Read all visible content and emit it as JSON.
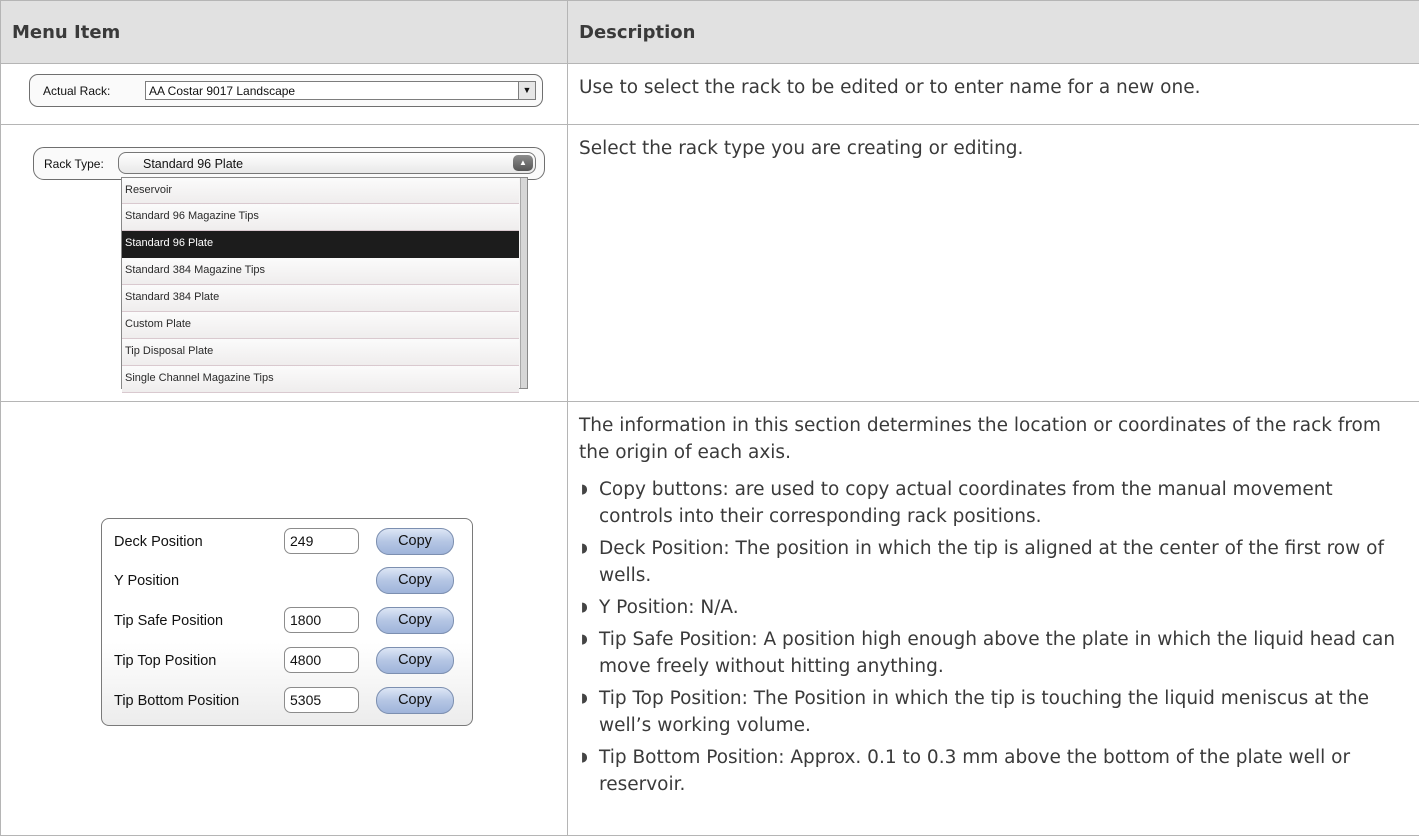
{
  "table": {
    "col_menu_item": "Menu Item",
    "col_description": "Description"
  },
  "actual_rack": {
    "label": "Actual Rack:",
    "value": "AA Costar 9017 Landscape",
    "dropdown_icon": "chevron-down-icon",
    "description": "Use to select the rack to be edited or to enter name for a new one."
  },
  "rack_type": {
    "label": "Rack Type:",
    "value": "Standard 96 Plate",
    "dropdown_icon": "chevron-up-icon",
    "options": [
      "Reservoir",
      "Standard 96 Magazine Tips",
      "Standard 96 Plate",
      "Standard 384 Magazine Tips",
      "Standard 384 Plate",
      "Custom Plate",
      "Tip Disposal Plate",
      "Single Channel Magazine Tips"
    ],
    "selected_option": "Standard 96 Plate",
    "description": "Select the rack type you are creating or editing."
  },
  "positions": {
    "rows": [
      {
        "label": "Deck Position",
        "value": "249",
        "button": "Copy"
      },
      {
        "label": "Y Position",
        "value": null,
        "button": "Copy"
      },
      {
        "label": "Tip Safe Position",
        "value": "1800",
        "button": "Copy"
      },
      {
        "label": "Tip Top Position",
        "value": "4800",
        "button": "Copy"
      },
      {
        "label": "Tip Bottom Position",
        "value": "5305",
        "button": "Copy"
      }
    ],
    "intro": "The information in this section determines the location or coordinates of the rack from the origin of each axis.",
    "bullet_marker": "◗",
    "bullets": [
      "Copy buttons: are used to copy actual coordinates from the manual movement controls into their corresponding rack positions.",
      "Deck Position: The position in which the tip is aligned at the center of the first row of wells.",
      "Y Position: N/A.",
      "Tip Safe Position: A position high enough above the plate in which the liquid head can move freely without hitting anything.",
      "Tip Top Position: The Position in which the tip is touching the liquid meniscus at the well’s working volume.",
      "Tip Bottom Position: Approx. 0.1 to 0.3 mm above the bottom of the plate well or reservoir."
    ]
  },
  "colors": {
    "header_bg": "#e1e1e1",
    "border": "#b5b5b5",
    "selected_option_bg": "#1c1c1c",
    "copy_button": "#b5c6e4"
  }
}
